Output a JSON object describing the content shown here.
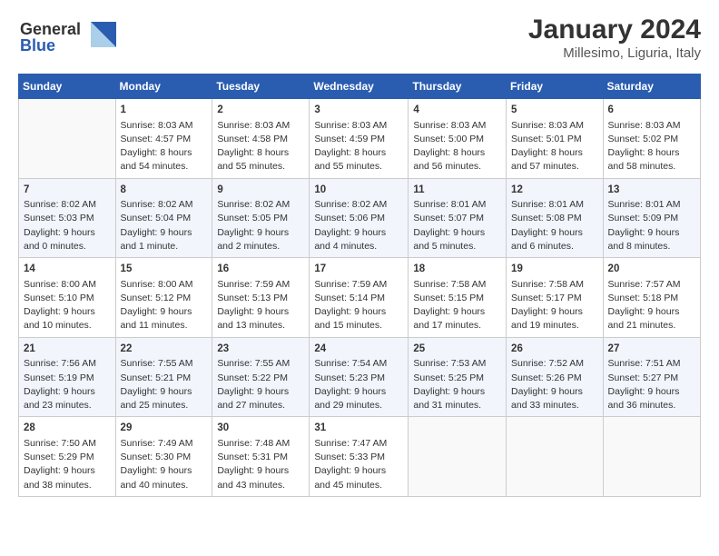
{
  "header": {
    "logo_line1": "General",
    "logo_line2": "Blue",
    "month": "January 2024",
    "location": "Millesimo, Liguria, Italy"
  },
  "columns": [
    "Sunday",
    "Monday",
    "Tuesday",
    "Wednesday",
    "Thursday",
    "Friday",
    "Saturday"
  ],
  "weeks": [
    [
      {
        "day": "",
        "content": ""
      },
      {
        "day": "1",
        "content": "Sunrise: 8:03 AM\nSunset: 4:57 PM\nDaylight: 8 hours\nand 54 minutes."
      },
      {
        "day": "2",
        "content": "Sunrise: 8:03 AM\nSunset: 4:58 PM\nDaylight: 8 hours\nand 55 minutes."
      },
      {
        "day": "3",
        "content": "Sunrise: 8:03 AM\nSunset: 4:59 PM\nDaylight: 8 hours\nand 55 minutes."
      },
      {
        "day": "4",
        "content": "Sunrise: 8:03 AM\nSunset: 5:00 PM\nDaylight: 8 hours\nand 56 minutes."
      },
      {
        "day": "5",
        "content": "Sunrise: 8:03 AM\nSunset: 5:01 PM\nDaylight: 8 hours\nand 57 minutes."
      },
      {
        "day": "6",
        "content": "Sunrise: 8:03 AM\nSunset: 5:02 PM\nDaylight: 8 hours\nand 58 minutes."
      }
    ],
    [
      {
        "day": "7",
        "content": "Sunrise: 8:02 AM\nSunset: 5:03 PM\nDaylight: 9 hours\nand 0 minutes."
      },
      {
        "day": "8",
        "content": "Sunrise: 8:02 AM\nSunset: 5:04 PM\nDaylight: 9 hours\nand 1 minute."
      },
      {
        "day": "9",
        "content": "Sunrise: 8:02 AM\nSunset: 5:05 PM\nDaylight: 9 hours\nand 2 minutes."
      },
      {
        "day": "10",
        "content": "Sunrise: 8:02 AM\nSunset: 5:06 PM\nDaylight: 9 hours\nand 4 minutes."
      },
      {
        "day": "11",
        "content": "Sunrise: 8:01 AM\nSunset: 5:07 PM\nDaylight: 9 hours\nand 5 minutes."
      },
      {
        "day": "12",
        "content": "Sunrise: 8:01 AM\nSunset: 5:08 PM\nDaylight: 9 hours\nand 6 minutes."
      },
      {
        "day": "13",
        "content": "Sunrise: 8:01 AM\nSunset: 5:09 PM\nDaylight: 9 hours\nand 8 minutes."
      }
    ],
    [
      {
        "day": "14",
        "content": "Sunrise: 8:00 AM\nSunset: 5:10 PM\nDaylight: 9 hours\nand 10 minutes."
      },
      {
        "day": "15",
        "content": "Sunrise: 8:00 AM\nSunset: 5:12 PM\nDaylight: 9 hours\nand 11 minutes."
      },
      {
        "day": "16",
        "content": "Sunrise: 7:59 AM\nSunset: 5:13 PM\nDaylight: 9 hours\nand 13 minutes."
      },
      {
        "day": "17",
        "content": "Sunrise: 7:59 AM\nSunset: 5:14 PM\nDaylight: 9 hours\nand 15 minutes."
      },
      {
        "day": "18",
        "content": "Sunrise: 7:58 AM\nSunset: 5:15 PM\nDaylight: 9 hours\nand 17 minutes."
      },
      {
        "day": "19",
        "content": "Sunrise: 7:58 AM\nSunset: 5:17 PM\nDaylight: 9 hours\nand 19 minutes."
      },
      {
        "day": "20",
        "content": "Sunrise: 7:57 AM\nSunset: 5:18 PM\nDaylight: 9 hours\nand 21 minutes."
      }
    ],
    [
      {
        "day": "21",
        "content": "Sunrise: 7:56 AM\nSunset: 5:19 PM\nDaylight: 9 hours\nand 23 minutes."
      },
      {
        "day": "22",
        "content": "Sunrise: 7:55 AM\nSunset: 5:21 PM\nDaylight: 9 hours\nand 25 minutes."
      },
      {
        "day": "23",
        "content": "Sunrise: 7:55 AM\nSunset: 5:22 PM\nDaylight: 9 hours\nand 27 minutes."
      },
      {
        "day": "24",
        "content": "Sunrise: 7:54 AM\nSunset: 5:23 PM\nDaylight: 9 hours\nand 29 minutes."
      },
      {
        "day": "25",
        "content": "Sunrise: 7:53 AM\nSunset: 5:25 PM\nDaylight: 9 hours\nand 31 minutes."
      },
      {
        "day": "26",
        "content": "Sunrise: 7:52 AM\nSunset: 5:26 PM\nDaylight: 9 hours\nand 33 minutes."
      },
      {
        "day": "27",
        "content": "Sunrise: 7:51 AM\nSunset: 5:27 PM\nDaylight: 9 hours\nand 36 minutes."
      }
    ],
    [
      {
        "day": "28",
        "content": "Sunrise: 7:50 AM\nSunset: 5:29 PM\nDaylight: 9 hours\nand 38 minutes."
      },
      {
        "day": "29",
        "content": "Sunrise: 7:49 AM\nSunset: 5:30 PM\nDaylight: 9 hours\nand 40 minutes."
      },
      {
        "day": "30",
        "content": "Sunrise: 7:48 AM\nSunset: 5:31 PM\nDaylight: 9 hours\nand 43 minutes."
      },
      {
        "day": "31",
        "content": "Sunrise: 7:47 AM\nSunset: 5:33 PM\nDaylight: 9 hours\nand 45 minutes."
      },
      {
        "day": "",
        "content": ""
      },
      {
        "day": "",
        "content": ""
      },
      {
        "day": "",
        "content": ""
      }
    ]
  ]
}
